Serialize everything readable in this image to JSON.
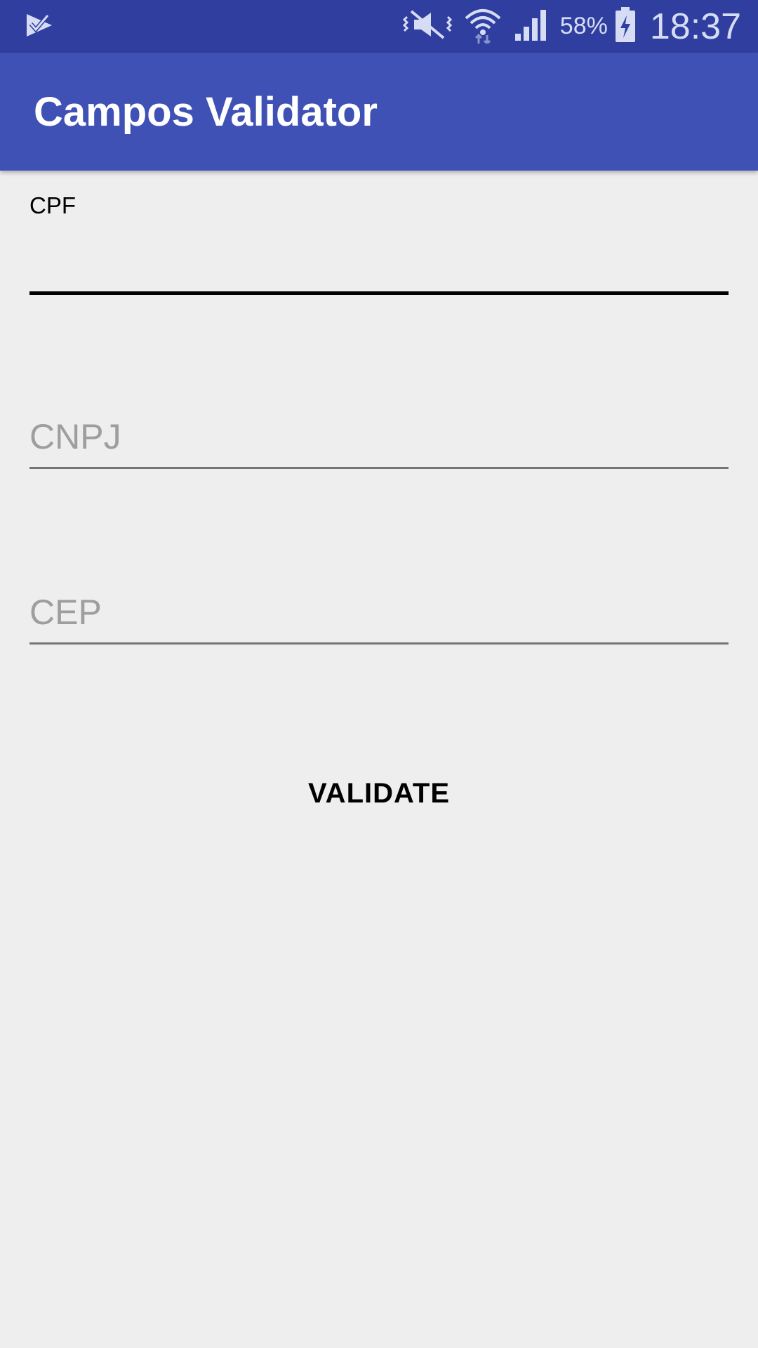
{
  "status_bar": {
    "battery": "58%",
    "time": "18:37",
    "icons": [
      "task-check-icon",
      "mute-vibrate-icon",
      "wifi-icon",
      "signal-icon",
      "battery-charging-icon"
    ]
  },
  "app_bar": {
    "title": "Campos Validator",
    "color": "#3f51b5"
  },
  "form": {
    "cpf": {
      "label": "CPF",
      "value": "",
      "placeholder": ""
    },
    "cnpj": {
      "placeholder": "CNPJ",
      "value": ""
    },
    "cep": {
      "placeholder": "CEP",
      "value": ""
    },
    "validate_label": "VALIDATE"
  },
  "colors": {
    "status_bar": "#303f9f",
    "background": "#eeeeee",
    "placeholder": "#9e9e9e"
  }
}
